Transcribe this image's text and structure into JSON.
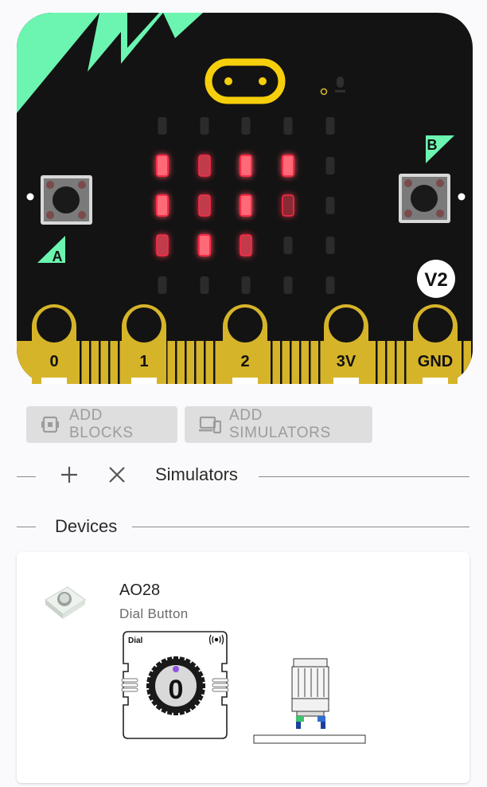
{
  "board": {
    "version_badge": "V2",
    "button_a_label": "A",
    "button_b_label": "B",
    "pins": [
      "0",
      "1",
      "2",
      "3V",
      "GND"
    ],
    "led_matrix": [
      [
        0,
        0,
        0,
        0,
        0
      ],
      [
        3,
        2,
        3,
        3,
        0
      ],
      [
        3,
        2,
        3,
        1,
        0
      ],
      [
        2,
        3,
        2,
        0,
        0
      ],
      [
        0,
        0,
        0,
        0,
        0
      ]
    ],
    "colors": {
      "body": "#131313",
      "accent": "#6bf5b0",
      "gold": "#d6b42a",
      "led_on": "#ff3a4f"
    }
  },
  "actions": {
    "add_blocks": "ADD BLOCKS",
    "add_simulators": "ADD SIMULATORS"
  },
  "simulators_section": {
    "title": "Simulators"
  },
  "devices_section": {
    "title": "Devices"
  },
  "device": {
    "name": "AO28",
    "type": "Dial Button",
    "dial_label": "Dial",
    "dial_value": "0",
    "wireless_icon": "wireless-icon"
  }
}
